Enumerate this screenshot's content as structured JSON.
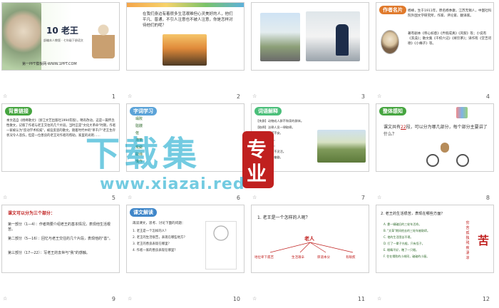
{
  "slides": [
    {
      "num": "1",
      "title": "10 老王",
      "subtitle": "部编本人教版 · 七年级下册语文",
      "footer": "第一PPT模板网-WWW.1PPT.COM"
    },
    {
      "num": "2",
      "text": "在我们身边有着很多生活艰难但心灵美好的人，他们平凡、普通，不引人注意也不被人注意，你是怎样对待他们的呢？"
    },
    {
      "num": "3"
    },
    {
      "num": "4",
      "tag": "作者名片",
      "text1": "杨绛，生于1911年，原名杨季康，江苏无锡人，中国社科院外国文学研究所，作家、评论家、翻译家。",
      "text2": "著有剧本《称心如意》《弄假成真》《风絮》等；小说有《洗澡》；散文集《干校六记》《将饮茶》；译作有《堂吉诃德》《小癞子》等。"
    },
    {
      "num": "5",
      "tag": "背景链接",
      "text": "本文选自《杨绛散文》（浙江文艺出版社1994年版）。略有改动，这是一篇怀念性散文，记叙了作者与老王交往的几个片段。当时正是\"文化大革命\"时期，作者一家被认为\"反动学术权威\"，被迫反思的散文。随着时代中的\"单干户\"老王生存状况令人悲伤，但是一位善良的老王对作者的帮助，家里的光明……"
    },
    {
      "num": "6",
      "tag": "字词学习",
      "rows": [
        "塌败",
        "骷髅",
        "伛",
        "滞笨",
        "荒僻",
        "取缔",
        "愧怍"
      ]
    },
    {
      "num": "7",
      "tag": "词语解释",
      "items": [
        "【失群】动物成人群不和家的群体。",
        "【取缔】法律人员一律取缔。",
        "【惶恐】惊慌不安。",
        "【愧怍】惭愧。",
        "【伛】弯着腰。",
        "【滞笨】呆滞不灵活。",
        "【荒僻】荒凉偏僻。"
      ]
    },
    {
      "num": "8",
      "tag": "整体感知",
      "q1": "课文共有",
      "q2": "22",
      "q3": "段，可以分为哪几部分，每个部分主要讲了什么？"
    },
    {
      "num": "9",
      "title": "课文可以分为三个部分：",
      "p1": "第一部分（1—4）：作者简要介绍老王的基本情况，表现他生活艰苦。",
      "p2": "第二部分（5—16）：回忆与老王交往的几个片段，表现他的\"善\"。",
      "p3": "第三部分（17—22）：写老王的去世与\"我\"的感触。"
    },
    {
      "num": "10",
      "tag": "课文解读",
      "intro": "再读课文，思考、讨论下面的问题：",
      "qs": [
        "1. 老王是一个怎样的人？",
        "2. 老王的生活很苦，表现在哪些地方？",
        "3. 老王的善良表现在哪里？",
        "4. 作者一家的善良表现在哪里？"
      ]
    },
    {
      "num": "11",
      "q": "1. 老王是一个怎样的人呢？",
      "center": "老人",
      "branches": [
        "地位卑下孤苦",
        "生活艰辛",
        "厚道本分",
        "有眼疾"
      ]
    },
    {
      "num": "12",
      "q": "2. 老王的生活很苦，表现在哪些方面？",
      "items": [
        "A. 靠一辆破旧的三轮车活命。",
        "B. \"文革\"期间他去的三轮车被取缔。",
        "C. 他的生活困苦不堪。",
        "D. 打了一辈子光棍，只有侄子。",
        "E. 眼睛不好，瞎了一只眼。",
        "F. 住在塌败的小胡同，破破的小屋。"
      ],
      "side": [
        "穷",
        "苦",
        "孤",
        "独",
        "残",
        "疾",
        "凄",
        "凉"
      ],
      "big": "苦"
    }
  ],
  "watermark": {
    "line1": "下载集",
    "line2": "专",
    "line3": "业",
    "url": "www.xiazai.red"
  },
  "colors": {
    "accent_green": "#46a540",
    "title_red": "#c0201f",
    "orange": "#f08c2a"
  }
}
